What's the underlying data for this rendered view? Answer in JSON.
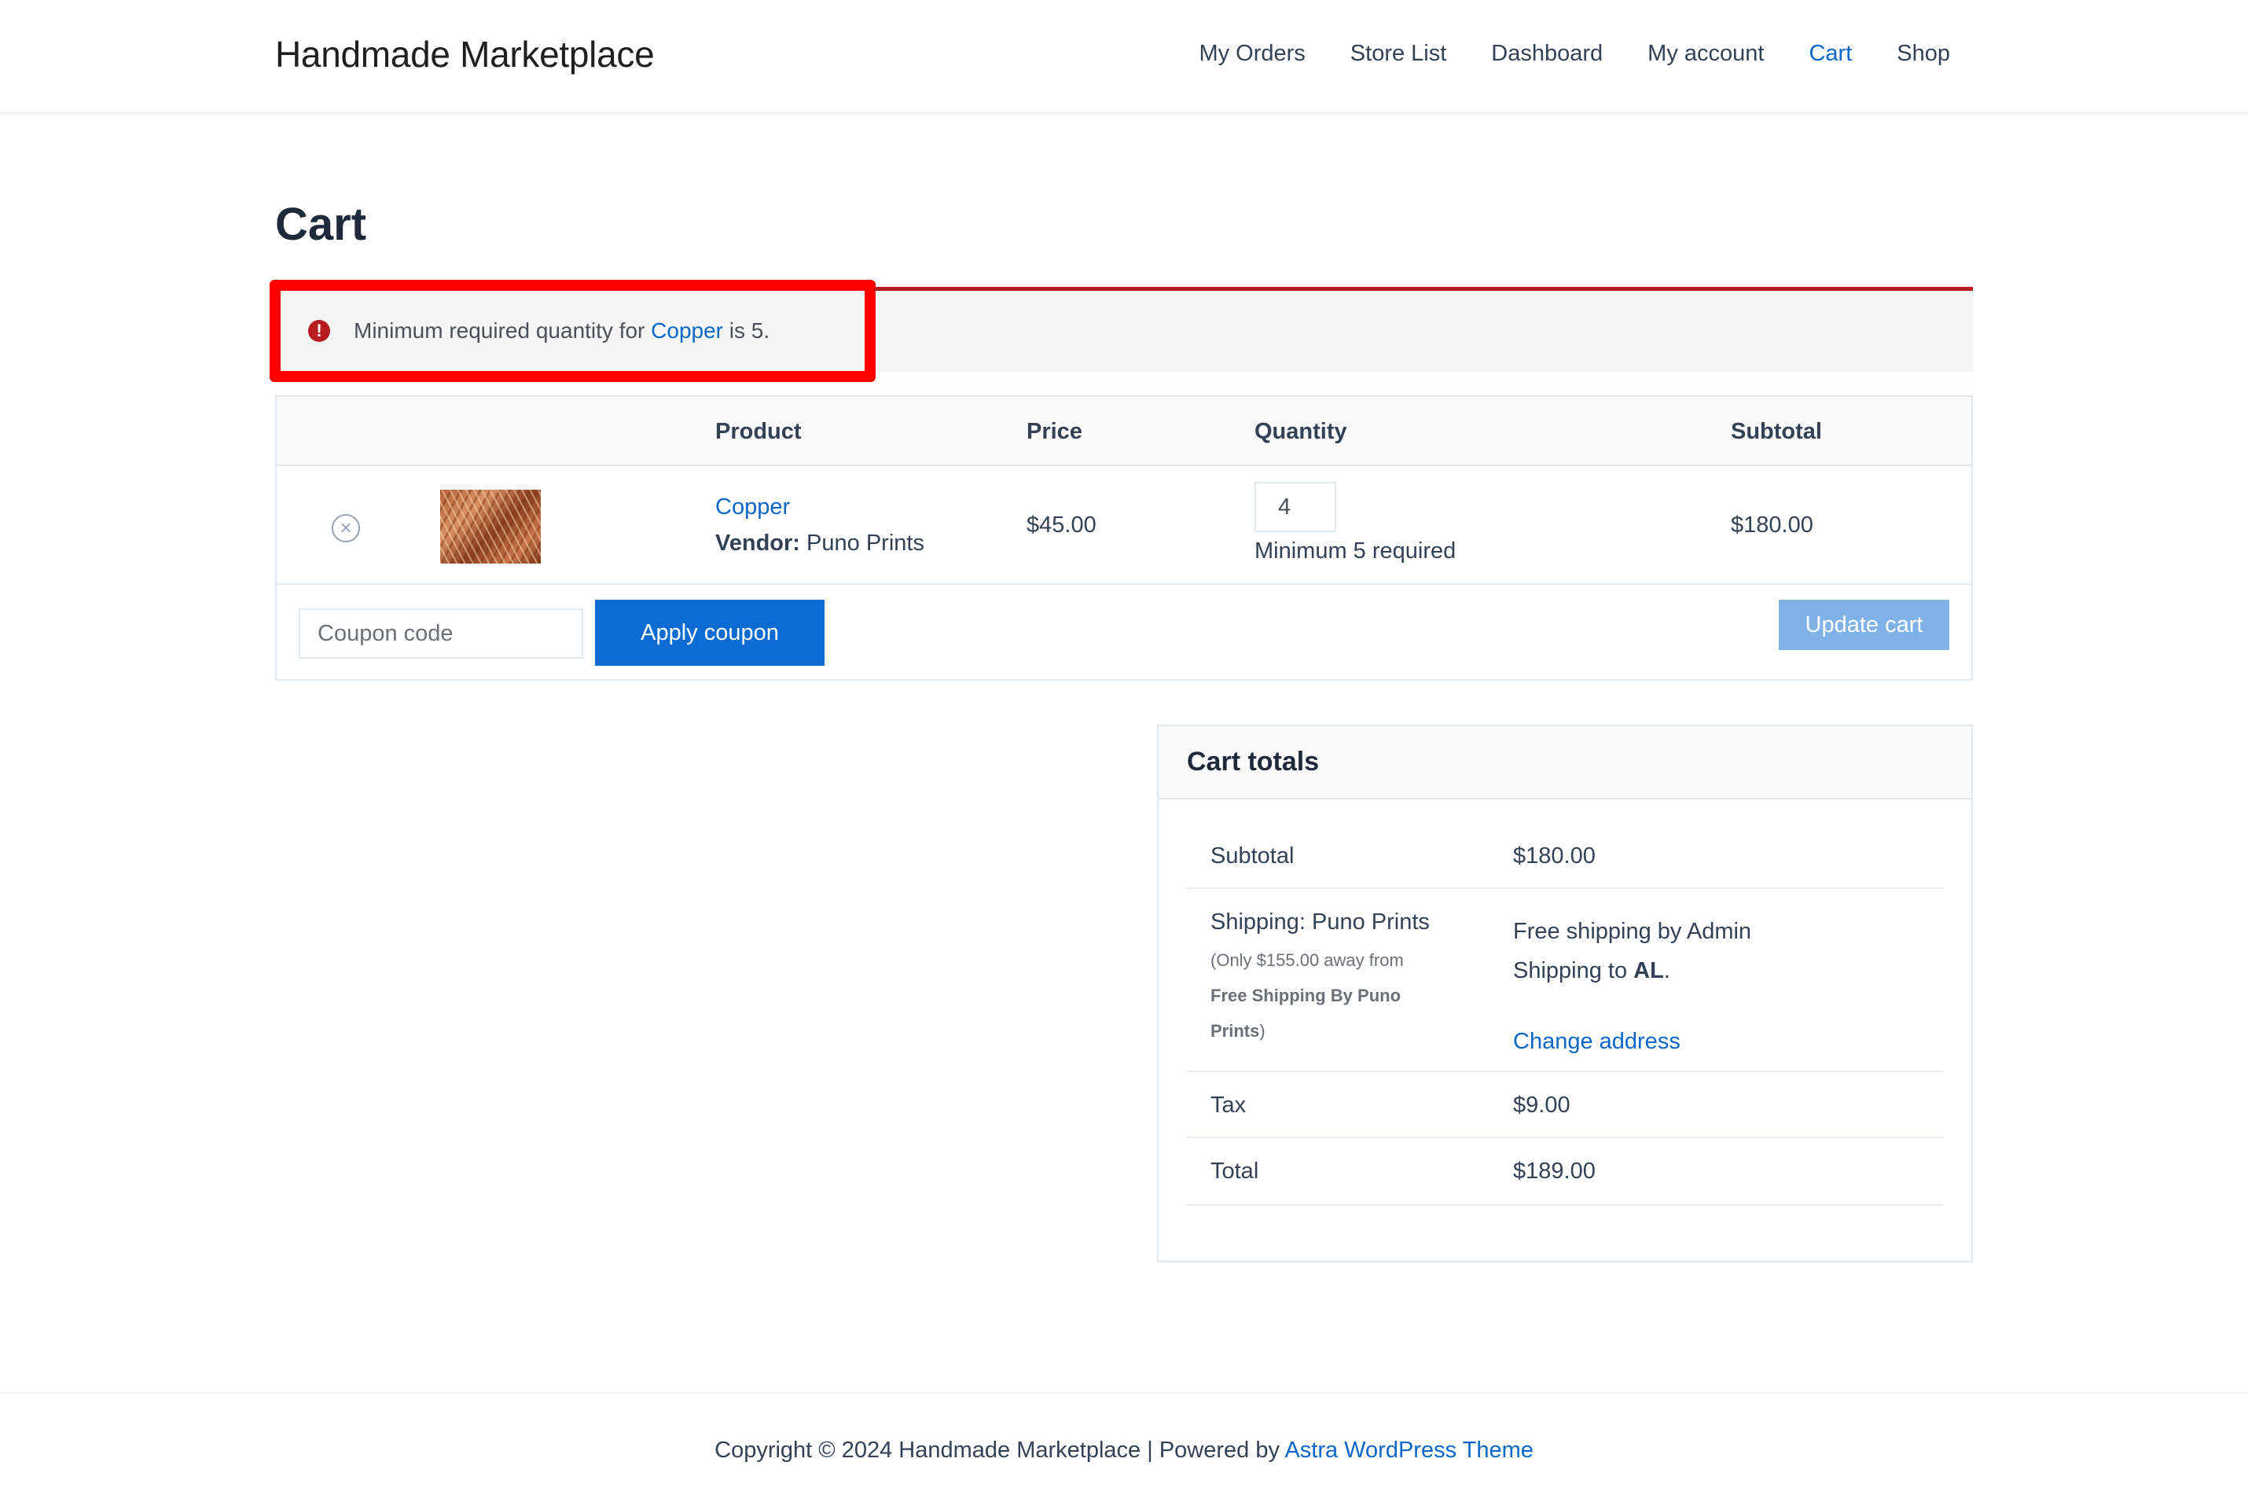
{
  "header": {
    "site_title": "Handmade Marketplace",
    "nav": [
      {
        "label": "My Orders",
        "active": false
      },
      {
        "label": "Store List",
        "active": false
      },
      {
        "label": "Dashboard",
        "active": false
      },
      {
        "label": "My account",
        "active": false
      },
      {
        "label": "Cart",
        "active": true
      },
      {
        "label": "Shop",
        "active": false
      }
    ]
  },
  "page": {
    "title": "Cart"
  },
  "notice": {
    "icon": "error-icon",
    "prefix": "Minimum required quantity for ",
    "link_text": "Copper",
    "suffix": " is 5.",
    "accent_color": "#b81c23"
  },
  "cart_table": {
    "headers": {
      "product": "Product",
      "price": "Price",
      "quantity": "Quantity",
      "subtotal": "Subtotal"
    },
    "items": [
      {
        "name": "Copper",
        "vendor_label": "Vendor:",
        "vendor": "Puno Prints",
        "price": "$45.00",
        "quantity": "4",
        "quantity_note": "Minimum 5 required",
        "subtotal": "$180.00",
        "remove_icon": "remove-circle-x-icon"
      }
    ],
    "coupon_placeholder": "Coupon code",
    "apply_coupon_label": "Apply coupon",
    "update_cart_label": "Update cart"
  },
  "cart_totals": {
    "title": "Cart totals",
    "subtotal_label": "Subtotal",
    "subtotal_value": "$180.00",
    "shipping_label": "Shipping: Puno Prints",
    "shipping_note_prefix": "(Only $155.00 away from ",
    "shipping_note_bold": "Free Shipping By Puno Prints",
    "shipping_note_suffix": ")",
    "shipping_method": "Free shipping by Admin",
    "shipping_to_prefix": "Shipping to ",
    "shipping_to_state": "AL",
    "shipping_to_suffix": ".",
    "change_address_label": "Change address",
    "tax_label": "Tax",
    "tax_value": "$9.00",
    "total_label": "Total",
    "total_value": "$189.00"
  },
  "footer": {
    "text": "Copyright © 2024 Handmade Marketplace | Powered by ",
    "link_text": "Astra WordPress Theme"
  },
  "colors": {
    "link": "#0a66c8",
    "primary_button": "#0a6bd3",
    "disabled_button": "#7fb3e7",
    "error": "#b81c23",
    "annotation_highlight": "#ff0000"
  }
}
